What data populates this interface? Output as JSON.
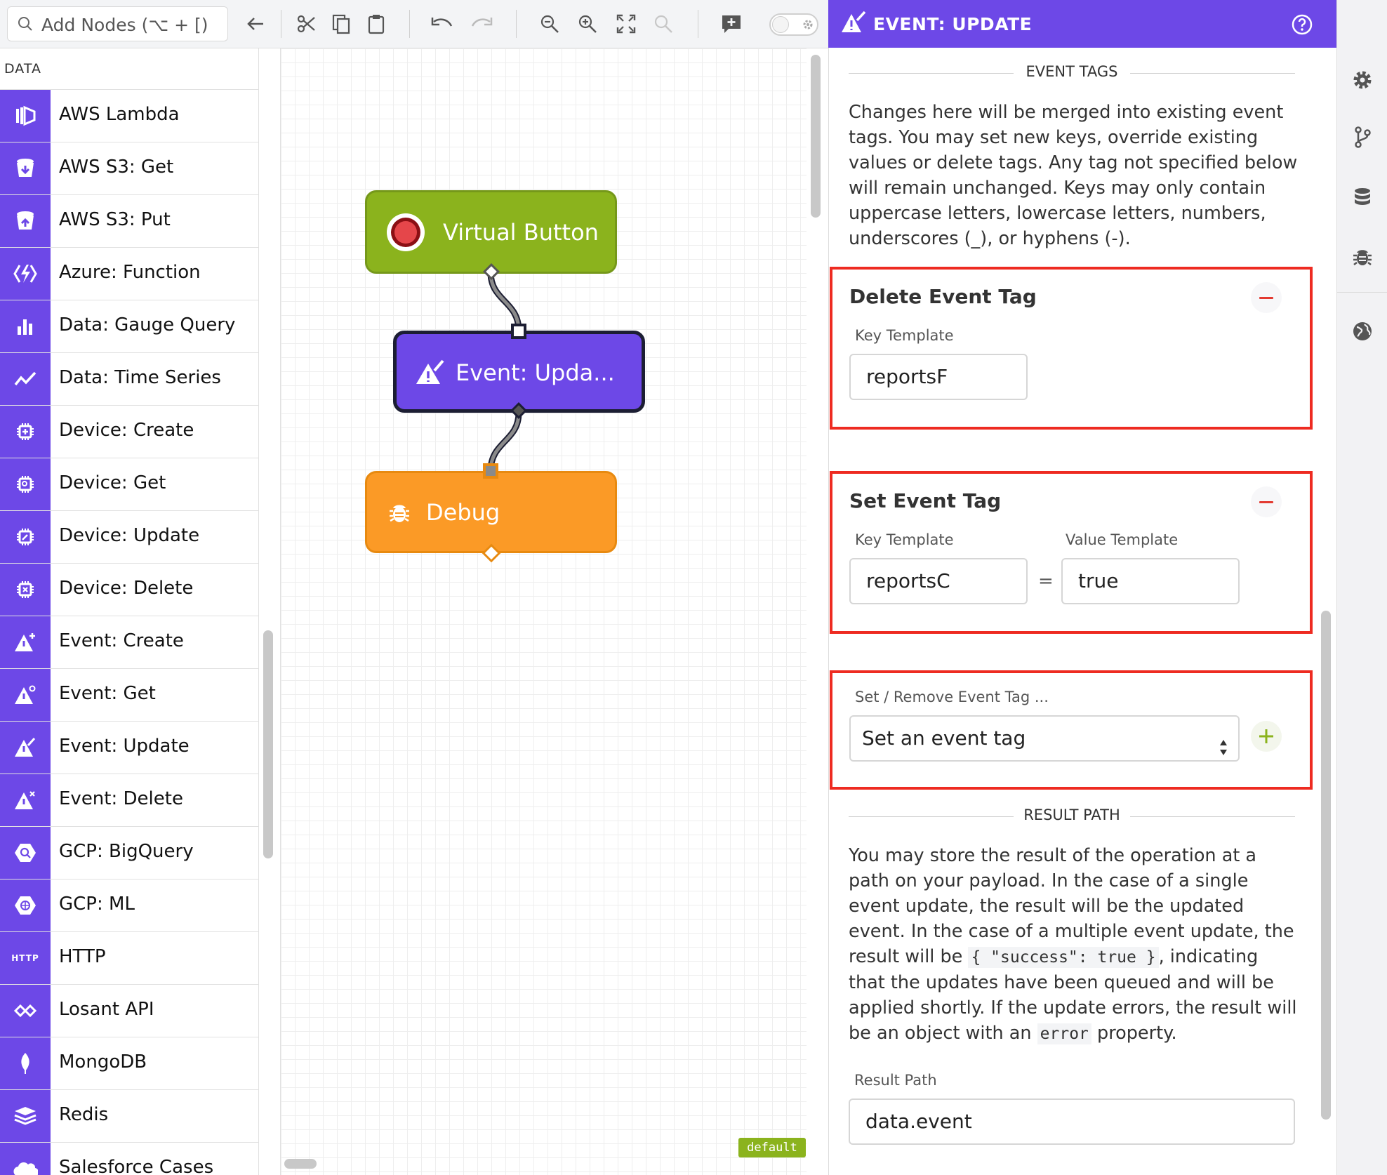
{
  "toolbar": {
    "search_placeholder": "Add Nodes (⌥ + [)"
  },
  "palette": {
    "header": "DATA",
    "items": [
      {
        "label": "AWS Lambda",
        "icon": "aws-lambda-icon"
      },
      {
        "label": "AWS S3: Get",
        "icon": "s3-get-icon"
      },
      {
        "label": "AWS S3: Put",
        "icon": "s3-put-icon"
      },
      {
        "label": "Azure: Function",
        "icon": "azure-function-icon"
      },
      {
        "label": "Data: Gauge Query",
        "icon": "bar-chart-icon"
      },
      {
        "label": "Data: Time Series",
        "icon": "line-chart-icon"
      },
      {
        "label": "Device: Create",
        "icon": "chip-icon"
      },
      {
        "label": "Device: Get",
        "icon": "chip-icon"
      },
      {
        "label": "Device: Update",
        "icon": "chip-icon"
      },
      {
        "label": "Device: Delete",
        "icon": "chip-icon"
      },
      {
        "label": "Event: Create",
        "icon": "warning-plus-icon"
      },
      {
        "label": "Event: Get",
        "icon": "warning-search-icon"
      },
      {
        "label": "Event: Update",
        "icon": "warning-edit-icon"
      },
      {
        "label": "Event: Delete",
        "icon": "warning-x-icon"
      },
      {
        "label": "GCP: BigQuery",
        "icon": "bigquery-icon"
      },
      {
        "label": "GCP: ML",
        "icon": "gcp-ml-icon"
      },
      {
        "label": "HTTP",
        "icon": "http-icon"
      },
      {
        "label": "Losant API",
        "icon": "losant-icon"
      },
      {
        "label": "MongoDB",
        "icon": "mongodb-leaf-icon"
      },
      {
        "label": "Redis",
        "icon": "redis-stack-icon"
      },
      {
        "label": "Salesforce Cases",
        "icon": "salesforce-cloud-icon"
      }
    ],
    "http_icon_text": "HTTP"
  },
  "canvas": {
    "nodes": {
      "virtual_button": "Virtual Button",
      "event_update": "Event: Upda...",
      "debug": "Debug"
    },
    "badge": "default"
  },
  "panel": {
    "title": "EVENT: UPDATE",
    "event_tags_heading": "EVENT TAGS",
    "event_tags_help": "Changes here will be merged into existing event tags. You may set new keys, override existing values or delete tags. Any tag not specified below will remain unchanged. Keys may only contain uppercase letters, lowercase letters, numbers, underscores (_), or hyphens (-).",
    "delete_tag": {
      "title": "Delete Event Tag",
      "key_label": "Key Template",
      "key_value": "reportsF"
    },
    "set_tag": {
      "title": "Set Event Tag",
      "key_label": "Key Template",
      "key_value": "reportsC",
      "equals": "=",
      "value_label": "Value Template",
      "value_value": "true"
    },
    "add_tag": {
      "label": "Set / Remove Event Tag ...",
      "selected": "Set an event tag"
    },
    "result_heading": "RESULT PATH",
    "result_help": {
      "part1": "You may store the result of the operation at a path on your payload. In the case of a single event update, the result will be the updated event. In the case of a multiple event update, the result will be",
      "code1": "{ \"success\": true }",
      "part2": ", indicating that the updates have been queued and will be applied shortly. If the update errors, the result will be an object with an",
      "code2": "error",
      "part3": "property."
    },
    "result_path_label": "Result Path",
    "result_path_value": "data.event"
  },
  "colors": {
    "accent_purple": "#6d48e7",
    "node_green": "#8bb31d",
    "node_orange": "#fb9a26",
    "highlight_red": "#ee2b21"
  }
}
